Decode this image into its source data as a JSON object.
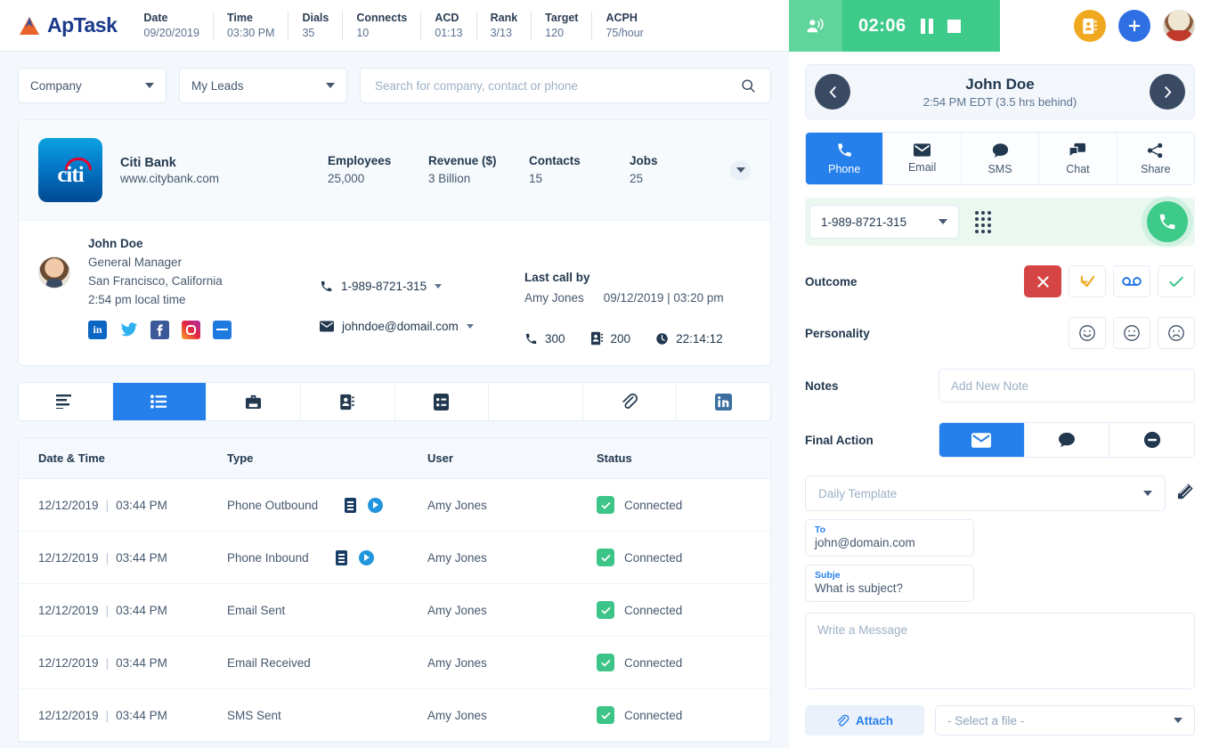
{
  "brand": {
    "name": "ApTask",
    "logo_icon": "aptask-mountain-logo"
  },
  "header_stats": [
    {
      "label": "Date",
      "value": "09/20/2019"
    },
    {
      "label": "Time",
      "value": "03:30 PM"
    },
    {
      "label": "Dials",
      "value": "35"
    },
    {
      "label": "Connects",
      "value": "10"
    },
    {
      "label": "ACD",
      "value": "01:13"
    },
    {
      "label": "Rank",
      "value": "3/13"
    },
    {
      "label": "Target",
      "value": "120"
    },
    {
      "label": "ACPH",
      "value": "75/hour"
    }
  ],
  "filters": {
    "entity_select": "Company",
    "list_select": "My Leads",
    "search_placeholder": "Search for company, contact or phone"
  },
  "company": {
    "logo_text": "citi",
    "name": "Citi Bank",
    "website": "www.citybank.com",
    "metrics": [
      {
        "label": "Employees",
        "value": "25,000"
      },
      {
        "label": "Revenue ($)",
        "value": "3 Billion"
      },
      {
        "label": "Contacts",
        "value": "15"
      },
      {
        "label": "Jobs",
        "value": "25"
      }
    ]
  },
  "contact": {
    "name": "John Doe",
    "title": "General Manager",
    "location": "San Francisco, California",
    "local_time": "2:54 pm local time",
    "socials": [
      "linkedin-icon",
      "twitter-icon",
      "facebook-icon",
      "instagram-icon",
      "job-board-icon"
    ],
    "phone": "1-989-8721-315",
    "email": "johndoe@domail.com",
    "last_call_label": "Last call by",
    "last_call_user": "Amy Jones",
    "last_call_time": "09/12/2019 | 03:20 pm",
    "calls_count": "300",
    "contacts_count": "200",
    "duration": "22:14:12"
  },
  "tabs": [
    {
      "icon": "align-left-icon",
      "active": false
    },
    {
      "icon": "list-icon",
      "active": true
    },
    {
      "icon": "briefcase-icon",
      "active": false
    },
    {
      "icon": "contact-card-icon",
      "active": false
    },
    {
      "icon": "list-detail-icon",
      "active": false
    },
    {
      "icon": "blank-icon",
      "active": false
    },
    {
      "icon": "paperclip-icon",
      "active": false
    },
    {
      "icon": "linkedin-icon",
      "active": false
    }
  ],
  "activity_table": {
    "columns": [
      "Date & Time",
      "Type",
      "User",
      "Status"
    ],
    "rows": [
      {
        "date": "12/12/2019",
        "time": "03:44 PM",
        "type": "Phone Outbound",
        "has_media": true,
        "user": "Amy Jones",
        "status": "Connected"
      },
      {
        "date": "12/12/2019",
        "time": "03:44 PM",
        "type": "Phone Inbound",
        "has_media": true,
        "user": "Amy Jones",
        "status": "Connected"
      },
      {
        "date": "12/12/2019",
        "time": "03:44 PM",
        "type": "Email Sent",
        "has_media": false,
        "user": "Amy Jones",
        "status": "Connected"
      },
      {
        "date": "12/12/2019",
        "time": "03:44 PM",
        "type": "Email Received",
        "has_media": false,
        "user": "Amy Jones",
        "status": "Connected"
      },
      {
        "date": "12/12/2019",
        "time": "03:44 PM",
        "type": "SMS Sent",
        "has_media": false,
        "user": "Amy Jones",
        "status": "Connected"
      }
    ]
  },
  "callbar": {
    "timer": "02:06",
    "broadcast_icon": "broadcast-icon",
    "pause_icon": "pause-icon",
    "stop_icon": "stop-icon",
    "contacts_icon": "contact-book-icon",
    "add_icon": "plus-icon",
    "avatar_icon": "user-avatar"
  },
  "right_panel": {
    "person_name": "John Doe",
    "person_time": "2:54 PM EDT (3.5 hrs behind)",
    "prev_icon": "chevron-left-icon",
    "next_icon": "chevron-right-icon",
    "channels": [
      {
        "label": "Phone",
        "icon": "phone-icon",
        "active": true
      },
      {
        "label": "Email",
        "icon": "envelope-icon",
        "active": false
      },
      {
        "label": "SMS",
        "icon": "chat-bubble-icon",
        "active": false
      },
      {
        "label": "Chat",
        "icon": "chat-double-icon",
        "active": false
      },
      {
        "label": "Share",
        "icon": "share-icon",
        "active": false
      }
    ],
    "dialer_number": "1-989-8721-315",
    "keypad_icon": "keypad-icon",
    "call_icon": "phone-call-icon",
    "outcome_label": "Outcome",
    "outcome_options": [
      "no-answer-x-icon",
      "callback-arrow-icon",
      "voicemail-icon",
      "connected-check-icon"
    ],
    "personality_label": "Personality",
    "personality_options": [
      "happy-face-icon",
      "neutral-face-icon",
      "sad-face-icon"
    ],
    "notes_label": "Notes",
    "notes_placeholder": "Add New Note",
    "final_action_label": "Final Action",
    "final_actions": [
      "email-icon",
      "sms-icon",
      "none-icon"
    ],
    "template_placeholder": "Daily Template",
    "compose_icon": "compose-edit-icon",
    "to_label": "To",
    "to_value": "john@domain.com",
    "subject_label": "Subje",
    "subject_value": "What is subject?",
    "message_placeholder": "Write a Message",
    "attach_label": "Attach",
    "attach_icon": "paperclip-icon",
    "file_select": "- Select a file -"
  }
}
